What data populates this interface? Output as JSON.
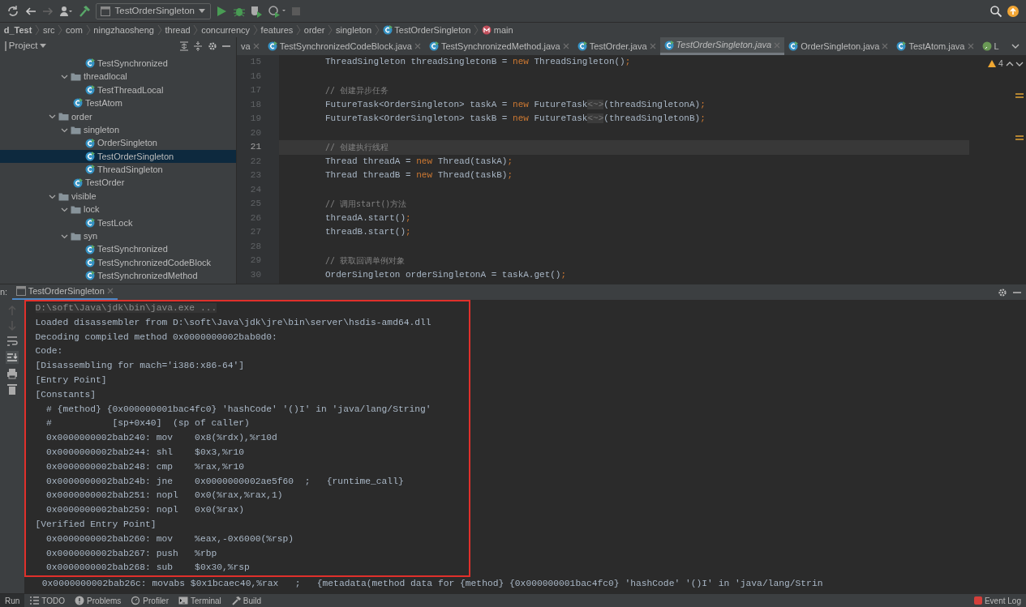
{
  "toolbar": {
    "run_config": "TestOrderSingleton"
  },
  "breadcrumb": [
    {
      "label": "d_Test",
      "kind": "module"
    },
    {
      "label": "src",
      "kind": "dir"
    },
    {
      "label": "com",
      "kind": "dir"
    },
    {
      "label": "ningzhaosheng",
      "kind": "dir"
    },
    {
      "label": "thread",
      "kind": "dir"
    },
    {
      "label": "concurrency",
      "kind": "dir"
    },
    {
      "label": "features",
      "kind": "dir"
    },
    {
      "label": "order",
      "kind": "dir"
    },
    {
      "label": "singleton",
      "kind": "dir"
    },
    {
      "label": "TestOrderSingleton",
      "kind": "class"
    },
    {
      "label": "main",
      "kind": "method"
    }
  ],
  "project": {
    "title": "Project",
    "tree": [
      {
        "kind": "continued",
        "children": [
          {
            "kind": "continued",
            "children": [
              {
                "kind": "class",
                "label": "TestSynchronized",
                "selected": false
              }
            ]
          },
          {
            "kind": "folder",
            "label": "threadlocal",
            "expanded": true,
            "children": [
              {
                "kind": "class",
                "label": "TestThreadLocal",
                "selected": false
              }
            ]
          },
          {
            "kind": "class",
            "label": "TestAtom",
            "selected": false
          }
        ]
      },
      {
        "kind": "folder",
        "label": "order",
        "expanded": true,
        "children": [
          {
            "kind": "folder",
            "label": "singleton",
            "expanded": true,
            "children": [
              {
                "kind": "class",
                "label": "OrderSingleton",
                "selected": false
              },
              {
                "kind": "class",
                "label": "TestOrderSingleton",
                "selected": true
              },
              {
                "kind": "class",
                "label": "ThreadSingleton",
                "selected": false
              }
            ]
          },
          {
            "kind": "class",
            "label": "TestOrder",
            "selected": false
          }
        ]
      },
      {
        "kind": "folder",
        "label": "visible",
        "expanded": true,
        "children": [
          {
            "kind": "folder",
            "label": "lock",
            "expanded": true,
            "children": [
              {
                "kind": "class",
                "label": "TestLock",
                "selected": false
              }
            ]
          },
          {
            "kind": "folder",
            "label": "syn",
            "expanded": true,
            "children": [
              {
                "kind": "class",
                "label": "TestSynchronized",
                "selected": false
              },
              {
                "kind": "class",
                "label": "TestSynchronizedCodeBlock",
                "selected": false
              },
              {
                "kind": "class",
                "label": "TestSynchronizedMethod",
                "selected": false
              }
            ]
          }
        ]
      }
    ]
  },
  "editor_tabs": [
    {
      "label": "va",
      "selected": false,
      "kind": "cut"
    },
    {
      "label": "TestSynchronizedCodeBlock.java",
      "selected": false,
      "kind": "class"
    },
    {
      "label": "TestSynchronizedMethod.java",
      "selected": false,
      "kind": "class"
    },
    {
      "label": "TestOrder.java",
      "selected": false,
      "kind": "class"
    },
    {
      "label": "TestOrderSingleton.java",
      "selected": true,
      "kind": "class"
    },
    {
      "label": "OrderSingleton.java",
      "selected": false,
      "kind": "class"
    },
    {
      "label": "TestAtom.java",
      "selected": false,
      "kind": "class"
    },
    {
      "label": "L",
      "selected": false,
      "kind": "test"
    }
  ],
  "editor": {
    "warnings": "4",
    "lines": [
      {
        "number": "15",
        "current": false,
        "tokens": [
          {
            "text": "ThreadSingleton threadSingletonB = ",
            "kind": "plain"
          },
          {
            "text": "new",
            "kind": "keyword"
          },
          {
            "text": " ThreadSingleton()",
            "kind": "plain"
          },
          {
            "text": ";",
            "kind": "keyword"
          }
        ]
      },
      {
        "number": "16",
        "current": false
      },
      {
        "number": "17",
        "current": false,
        "tokens": [
          {
            "text": "// 创建异步任务",
            "kind": "comment"
          }
        ]
      },
      {
        "number": "18",
        "current": false,
        "tokens": [
          {
            "text": "FutureTask<OrderSingleton> taskA = ",
            "kind": "plain"
          },
          {
            "text": "new",
            "kind": "keyword"
          },
          {
            "text": " FutureTask",
            "kind": "plain"
          },
          {
            "text": "<~>",
            "kind": "hint"
          },
          {
            "text": "(threadSingletonA)",
            "kind": "plain"
          },
          {
            "text": ";",
            "kind": "keyword"
          }
        ]
      },
      {
        "number": "19",
        "current": false,
        "tokens": [
          {
            "text": "FutureTask<OrderSingleton> taskB = ",
            "kind": "plain"
          },
          {
            "text": "new",
            "kind": "keyword"
          },
          {
            "text": " FutureTask",
            "kind": "plain"
          },
          {
            "text": "<~>",
            "kind": "hint"
          },
          {
            "text": "(threadSingletonB)",
            "kind": "plain"
          },
          {
            "text": ";",
            "kind": "keyword"
          }
        ]
      },
      {
        "number": "20",
        "current": false
      },
      {
        "number": "21",
        "current": true,
        "tokens": [
          {
            "text": "// 创建执行线程",
            "kind": "comment"
          }
        ]
      },
      {
        "number": "22",
        "current": false,
        "tokens": [
          {
            "text": "Thread threadA = ",
            "kind": "plain"
          },
          {
            "text": "new",
            "kind": "keyword"
          },
          {
            "text": " Thread(taskA)",
            "kind": "plain"
          },
          {
            "text": ";",
            "kind": "keyword"
          }
        ]
      },
      {
        "number": "23",
        "current": false,
        "tokens": [
          {
            "text": "Thread threadB = ",
            "kind": "plain"
          },
          {
            "text": "new",
            "kind": "keyword"
          },
          {
            "text": " Thread(taskB)",
            "kind": "plain"
          },
          {
            "text": ";",
            "kind": "keyword"
          }
        ]
      },
      {
        "number": "24",
        "current": false
      },
      {
        "number": "25",
        "current": false,
        "tokens": [
          {
            "text": "// 调用start()方法",
            "kind": "comment"
          }
        ]
      },
      {
        "number": "26",
        "current": false,
        "tokens": [
          {
            "text": "threadA.start()",
            "kind": "plain"
          },
          {
            "text": ";",
            "kind": "keyword"
          }
        ]
      },
      {
        "number": "27",
        "current": false,
        "tokens": [
          {
            "text": "threadB.start()",
            "kind": "plain"
          },
          {
            "text": ";",
            "kind": "keyword"
          }
        ]
      },
      {
        "number": "28",
        "current": false
      },
      {
        "number": "29",
        "current": false,
        "tokens": [
          {
            "text": "// 获取回调单例对象",
            "kind": "comment"
          }
        ]
      },
      {
        "number": "30",
        "current": false,
        "tokens": [
          {
            "text": "OrderSingleton orderSingletonA = taskA.get()",
            "kind": "plain"
          },
          {
            "text": ";",
            "kind": "keyword"
          }
        ]
      }
    ]
  },
  "run": {
    "label": "n:",
    "tab": "TestOrderSingleton",
    "highlighted_lines": [
      {
        "text": "D:\\soft\\Java\\jdk\\bin\\java.exe ...",
        "kind": "command"
      },
      {
        "text": "Loaded disassembler from D:\\soft\\Java\\jdk\\jre\\bin\\server\\hsdis-amd64.dll",
        "kind": "output"
      },
      {
        "text": "Decoding compiled method 0x0000000002bab0d0:",
        "kind": "output"
      },
      {
        "text": "Code:",
        "kind": "output"
      },
      {
        "text": "[Disassembling for mach='i386:x86-64']",
        "kind": "output"
      },
      {
        "text": "[Entry Point]",
        "kind": "output"
      },
      {
        "text": "[Constants]",
        "kind": "output"
      },
      {
        "text": "  # {method} {0x000000001bac4fc0} 'hashCode' '()I' in 'java/lang/String'",
        "kind": "output"
      },
      {
        "text": "  #           [sp+0x40]  (sp of caller)",
        "kind": "output"
      },
      {
        "text": "  0x0000000002bab240: mov    0x8(%rdx),%r10d",
        "kind": "output"
      },
      {
        "text": "  0x0000000002bab244: shl    $0x3,%r10",
        "kind": "output"
      },
      {
        "text": "  0x0000000002bab248: cmp    %rax,%r10",
        "kind": "output"
      },
      {
        "text": "  0x0000000002bab24b: jne    0x0000000002ae5f60  ;   {runtime_call}",
        "kind": "output"
      },
      {
        "text": "  0x0000000002bab251: nopl   0x0(%rax,%rax,1)",
        "kind": "output"
      },
      {
        "text": "  0x0000000002bab259: nopl   0x0(%rax)",
        "kind": "output"
      },
      {
        "text": "[Verified Entry Point]",
        "kind": "output"
      },
      {
        "text": "  0x0000000002bab260: mov    %eax,-0x6000(%rsp)",
        "kind": "output"
      },
      {
        "text": "  0x0000000002bab267: push   %rbp",
        "kind": "output"
      },
      {
        "text": "  0x0000000002bab268: sub    $0x30,%rsp",
        "kind": "output"
      }
    ],
    "lines": [
      {
        "text": "  0x0000000002bab26c: movabs $0x1bcaec40,%rax   ;   {metadata(method data for {method} {0x000000001bac4fc0} 'hashCode' '()I' in 'java/lang/Strin",
        "kind": "output"
      }
    ]
  },
  "bottom_tabs": [
    {
      "label": "Run",
      "selected": true,
      "kind": "run"
    },
    {
      "label": "TODO",
      "selected": false,
      "kind": "todo"
    },
    {
      "label": "Problems",
      "selected": false,
      "kind": "problems"
    },
    {
      "label": "Profiler",
      "selected": false,
      "kind": "profiler"
    },
    {
      "label": "Terminal",
      "selected": false,
      "kind": "terminal"
    },
    {
      "label": "Build",
      "selected": false,
      "kind": "build"
    }
  ],
  "event_log": "Event Log"
}
